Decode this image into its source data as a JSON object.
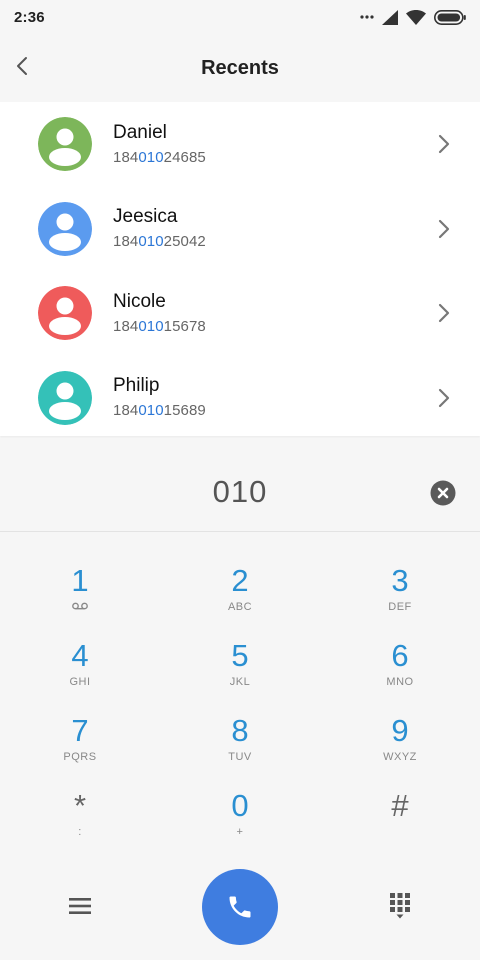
{
  "status_bar": {
    "time": "2:36",
    "icons": [
      "more-dots-icon",
      "signal-icon",
      "wifi-icon",
      "battery-icon"
    ]
  },
  "header": {
    "title": "Recents",
    "back_icon": "chevron-left-icon"
  },
  "colors": {
    "accent": "#2b76d6",
    "call_button": "#3f7de0",
    "digit_blue": "#2a8fd1"
  },
  "contacts": [
    {
      "name": "Daniel",
      "number_prefix": "184",
      "number_match": "010",
      "number_suffix": "24685",
      "avatar_color": "#7db65a"
    },
    {
      "name": "Jeesica",
      "number_prefix": "184",
      "number_match": "010",
      "number_suffix": "25042",
      "avatar_color": "#5b9bef"
    },
    {
      "name": "Nicole",
      "number_prefix": "184",
      "number_match": "010",
      "number_suffix": "15678",
      "avatar_color": "#ef5b5b"
    },
    {
      "name": "Philip",
      "number_prefix": "184",
      "number_match": "010",
      "number_suffix": "15689",
      "avatar_color": "#34c1b8"
    }
  ],
  "dial_input": {
    "value": "010"
  },
  "keypad": [
    {
      "digit": "1",
      "letters": "",
      "icon": "voicemail-icon"
    },
    {
      "digit": "2",
      "letters": "ABC"
    },
    {
      "digit": "3",
      "letters": "DEF"
    },
    {
      "digit": "4",
      "letters": "GHI"
    },
    {
      "digit": "5",
      "letters": "JKL"
    },
    {
      "digit": "6",
      "letters": "MNO"
    },
    {
      "digit": "7",
      "letters": "PQRS"
    },
    {
      "digit": "8",
      "letters": "TUV"
    },
    {
      "digit": "9",
      "letters": "WXYZ"
    },
    {
      "digit": "*",
      "letters": ":"
    },
    {
      "digit": "0",
      "letters": "+"
    },
    {
      "digit": "#",
      "letters": ""
    }
  ],
  "bottom_bar": {
    "icons": [
      "menu-icon",
      "phone-icon",
      "dialpad-icon"
    ]
  }
}
